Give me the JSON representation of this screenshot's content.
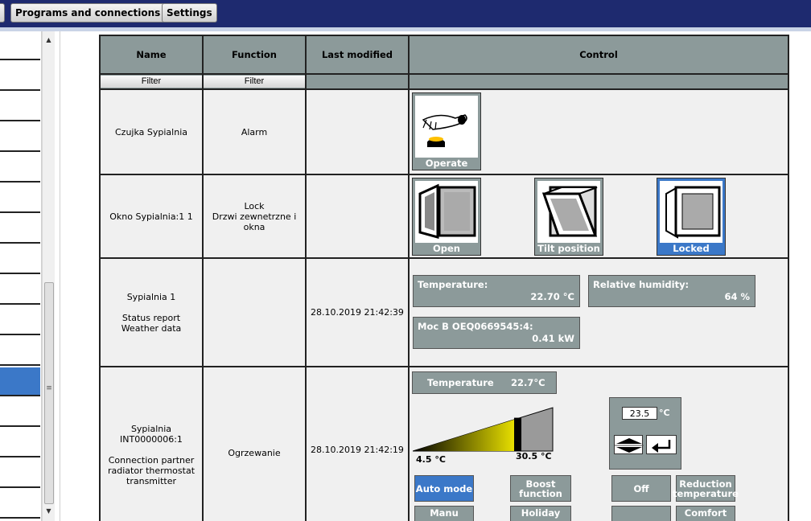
{
  "toolbar": {
    "programs_label": "Programs and connections",
    "settings_label": "Settings"
  },
  "table": {
    "headers": {
      "name": "Name",
      "function": "Function",
      "last_modified": "Last modified",
      "control": "Control"
    },
    "filter_label": "Filter"
  },
  "rows": [
    {
      "name": "Czujka Sypialnia",
      "function": "Alarm",
      "last_modified": "",
      "controls": {
        "operate": "Operate"
      }
    },
    {
      "name": "Okno Sypialnia:1 1",
      "function": "Lock\nDrzwi zewnetrzne i okna",
      "last_modified": "",
      "controls": {
        "open": "Open",
        "tilt": "Tilt position",
        "locked": "Locked"
      }
    },
    {
      "name": "Sypialnia 1\n\nStatus report\nWeather data",
      "function": "",
      "last_modified": "28.10.2019 21:42:39",
      "values": {
        "temperature_label": "Temperature:",
        "temperature_value": "22.70 °C",
        "humidity_label": "Relative humidity:",
        "humidity_value": "64 %",
        "power_label": "Moc B OEQ0669545:4:",
        "power_value": "0.41 kW"
      }
    },
    {
      "name": "Sypialnia\nINT0000006:1\n\nConnection partner radiator thermostat transmitter",
      "function": "Ogrzewanie",
      "last_modified": "28.10.2019 21:42:19",
      "thermostat": {
        "temperature_label": "Temperature",
        "temperature_value": "22.7°C",
        "min_label": "4.5 °C",
        "max_label": "30.5 °C",
        "setpoint": "23.5",
        "unit": "°C",
        "setpoint_fraction": 0.73,
        "buttons": {
          "auto": "Auto mode",
          "boost": "Boost function",
          "off": "Off",
          "reduction": "Reduction temperature",
          "manu": "Manu",
          "holiday": "Holiday",
          "comfort": "Comfort"
        }
      }
    }
  ],
  "colors": {
    "header_bar": "#1e2a6f",
    "cell_gray": "#8c9a9a",
    "active_blue": "#3b78c8",
    "row_bg": "#f0f0f0"
  }
}
